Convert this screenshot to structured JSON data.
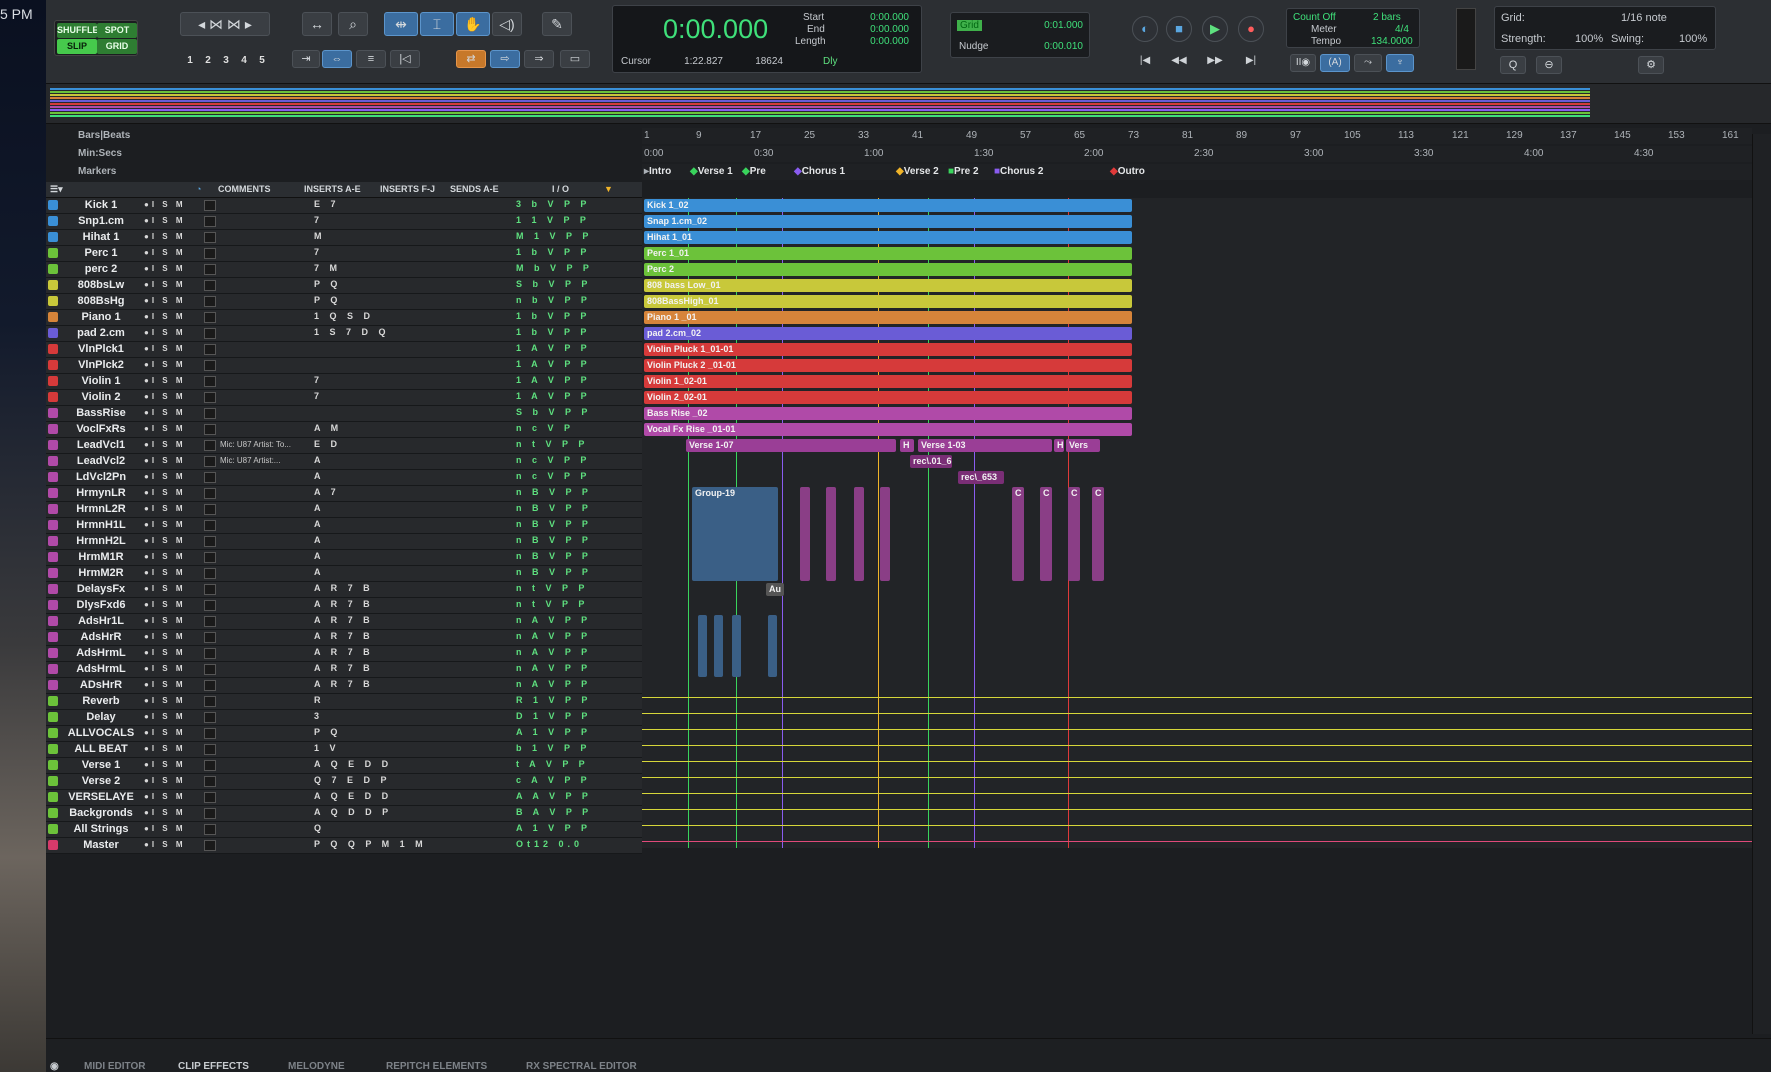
{
  "desktop": {
    "clock": "5 PM"
  },
  "toolbar": {
    "modes": {
      "shuffle": "SHUFFLE",
      "spot": "SPOT",
      "slip": "SLIP",
      "grid": "GRID"
    },
    "zoom_presets": [
      "1",
      "2",
      "3",
      "4",
      "5"
    ],
    "counter": {
      "main": "0:00.000",
      "start_label": "Start",
      "end_label": "End",
      "length_label": "Length",
      "start": "0:00.000",
      "end": "0:00.000",
      "length": "0:00.000",
      "cursor_label": "Cursor",
      "cursor": "1:22.827",
      "sample": "18624",
      "dly": "Dly"
    },
    "grid": {
      "label": "Grid",
      "value": "0:01.000",
      "nudge_label": "Nudge",
      "nudge_value": "0:00.010"
    },
    "meter": {
      "count_off": "Count Off",
      "bars": "2 bars",
      "meter_label": "Meter",
      "meter_value": "4/4",
      "tempo_label": "Tempo",
      "tempo_value": "134.0000"
    },
    "right": {
      "grid_label": "Grid:",
      "grid_note": "1/16 note",
      "strength_label": "Strength:",
      "strength": "100%",
      "swing_label": "Swing:",
      "swing": "100%"
    }
  },
  "rulers": {
    "bars_label": "Bars|Beats",
    "minsecs_label": "Min:Secs",
    "markers_label": "Markers",
    "bars": [
      "1",
      "9",
      "17",
      "25",
      "33",
      "41",
      "49",
      "57",
      "65",
      "73",
      "81",
      "89",
      "97",
      "105",
      "113",
      "121",
      "129",
      "137",
      "145",
      "153",
      "161"
    ],
    "secs": [
      "0:00",
      "0:30",
      "1:00",
      "1:30",
      "2:00",
      "2:30",
      "3:00",
      "3:30",
      "4:00",
      "4:30"
    ],
    "markers": [
      {
        "name": "Intro",
        "color": "#aab0b6"
      },
      {
        "name": "Verse 1",
        "color": "#39d45c"
      },
      {
        "name": "Pre",
        "color": "#39d45c"
      },
      {
        "name": "Chorus 1",
        "color": "#8a5cf0"
      },
      {
        "name": "Verse 2",
        "color": "#f0b429"
      },
      {
        "name": "Pre 2",
        "color": "#39d45c"
      },
      {
        "name": "Chorus 2",
        "color": "#8a5cf0"
      },
      {
        "name": "Outro",
        "color": "#e03a3a"
      }
    ]
  },
  "columns": {
    "comments": "COMMENTS",
    "inserts_ae": "INSERTS A-E",
    "inserts_fj": "INSERTS F-J",
    "sends_ae": "SENDS A-E",
    "io": "I / O"
  },
  "tracks": [
    {
      "name": "Kick 1",
      "color": "#3a8fd6",
      "ins": "E 7",
      "comment": "",
      "io": "3 b V P P"
    },
    {
      "name": "Snp1.cm",
      "color": "#3a8fd6",
      "ins": "7",
      "comment": "",
      "io": "1 1 V P P"
    },
    {
      "name": "Hihat 1",
      "color": "#3a8fd6",
      "ins": "M",
      "comment": "",
      "io": "M 1 V P P"
    },
    {
      "name": "Perc 1",
      "color": "#6cc23a",
      "ins": "7",
      "comment": "",
      "io": "1 b V P P"
    },
    {
      "name": "perc 2",
      "color": "#6cc23a",
      "ins": "7 M",
      "comment": "",
      "io": "M b V P P"
    },
    {
      "name": "808bsLw",
      "color": "#c8c83a",
      "ins": "P Q",
      "comment": "",
      "io": "S b V P P"
    },
    {
      "name": "808BsHg",
      "color": "#c8c83a",
      "ins": "P Q",
      "comment": "",
      "io": "n b V P P"
    },
    {
      "name": "Piano 1",
      "color": "#d6843a",
      "ins": "1 Q S D",
      "comment": "",
      "io": "1 b V P P"
    },
    {
      "name": "pad 2.cm",
      "color": "#6a5cd6",
      "ins": "1 S 7 D Q",
      "comment": "",
      "io": "1 b V P P"
    },
    {
      "name": "VlnPlck1",
      "color": "#d63a3a",
      "ins": "",
      "comment": "",
      "io": "1 A V P P"
    },
    {
      "name": "VlnPlck2",
      "color": "#d63a3a",
      "ins": "",
      "comment": "",
      "io": "1 A V P P"
    },
    {
      "name": "Violin 1",
      "color": "#d63a3a",
      "ins": "7",
      "comment": "",
      "io": "1 A V P P"
    },
    {
      "name": "Violin 2",
      "color": "#d63a3a",
      "ins": "7",
      "comment": "",
      "io": "1 A V P P"
    },
    {
      "name": "BassRise",
      "color": "#b04aa8",
      "ins": "",
      "comment": "",
      "io": "S b V P P"
    },
    {
      "name": "VoclFxRs",
      "color": "#b04aa8",
      "ins": "A M",
      "comment": "",
      "io": "n c V P"
    },
    {
      "name": "LeadVcl1",
      "color": "#b04aa8",
      "ins": "E D",
      "comment": "Mic: U87 Artist: To...",
      "io": "n t V P P"
    },
    {
      "name": "LeadVcl2",
      "color": "#b04aa8",
      "ins": "A",
      "comment": "Mic: U87 Artist:...",
      "io": "n c V P P"
    },
    {
      "name": "LdVcl2Pn",
      "color": "#b04aa8",
      "ins": "A",
      "comment": "",
      "io": "n c V P P"
    },
    {
      "name": "HrmynLR",
      "color": "#b04aa8",
      "ins": "A 7",
      "comment": "",
      "io": "n B V P P"
    },
    {
      "name": "HrmnL2R",
      "color": "#b04aa8",
      "ins": "A",
      "comment": "",
      "io": "n B V P P"
    },
    {
      "name": "HrmnH1L",
      "color": "#b04aa8",
      "ins": "A",
      "comment": "",
      "io": "n B V P P"
    },
    {
      "name": "HrmnH2L",
      "color": "#b04aa8",
      "ins": "A",
      "comment": "",
      "io": "n B V P P"
    },
    {
      "name": "HrmM1R",
      "color": "#b04aa8",
      "ins": "A",
      "comment": "",
      "io": "n B V P P"
    },
    {
      "name": "HrmM2R",
      "color": "#b04aa8",
      "ins": "A",
      "comment": "",
      "io": "n B V P P"
    },
    {
      "name": "DelaysFx",
      "color": "#b04aa8",
      "ins": "A R 7 B",
      "comment": "",
      "io": "n t V P P"
    },
    {
      "name": "DlysFxd6",
      "color": "#b04aa8",
      "ins": "A R 7 B",
      "comment": "",
      "io": "n t V P P"
    },
    {
      "name": "AdsHr1L",
      "color": "#b04aa8",
      "ins": "A R 7 B",
      "comment": "",
      "io": "n A V P P"
    },
    {
      "name": "AdsHrR",
      "color": "#b04aa8",
      "ins": "A R 7 B",
      "comment": "",
      "io": "n A V P P"
    },
    {
      "name": "AdsHrmL",
      "color": "#b04aa8",
      "ins": "A R 7 B",
      "comment": "",
      "io": "n A V P P"
    },
    {
      "name": "AdsHrmL",
      "color": "#b04aa8",
      "ins": "A R 7 B",
      "comment": "",
      "io": "n A V P P"
    },
    {
      "name": "ADsHrR",
      "color": "#b04aa8",
      "ins": "A R 7 B",
      "comment": "",
      "io": "n A V P P"
    },
    {
      "name": "Reverb",
      "color": "#6cc23a",
      "ins": "R",
      "comment": "",
      "io": "R 1 V P P"
    },
    {
      "name": "Delay",
      "color": "#6cc23a",
      "ins": "3",
      "comment": "",
      "io": "D 1 V P P"
    },
    {
      "name": "ALLVOCALS",
      "color": "#6cc23a",
      "ins": "P Q",
      "comment": "",
      "io": "A 1 V P P"
    },
    {
      "name": "ALL BEAT",
      "color": "#6cc23a",
      "ins": "1 V",
      "comment": "",
      "io": "b 1 V P P"
    },
    {
      "name": "Verse 1",
      "color": "#6cc23a",
      "ins": "A Q E D D",
      "comment": "",
      "io": "t A V P P"
    },
    {
      "name": "Verse 2",
      "color": "#6cc23a",
      "ins": "Q 7 E D P",
      "comment": "",
      "io": "c A V P P"
    },
    {
      "name": "VERSELAYE",
      "color": "#6cc23a",
      "ins": "A Q E D D",
      "comment": "",
      "io": "A A V P P"
    },
    {
      "name": "Backgronds",
      "color": "#6cc23a",
      "ins": "A Q D D P",
      "comment": "",
      "io": "B A V P P"
    },
    {
      "name": "All Strings",
      "color": "#6cc23a",
      "ins": "Q",
      "comment": "",
      "io": "A 1 V P P"
    },
    {
      "name": "Master",
      "color": "#d63a6a",
      "ins": "P Q Q P M 1 M",
      "comment": "",
      "io": "Ot12 0.0"
    }
  ],
  "clips": [
    {
      "label": "Kick 1_02",
      "color": "#3a8fd6"
    },
    {
      "label": "Snap 1.cm_02",
      "color": "#3a8fd6"
    },
    {
      "label": "Hihat 1_01",
      "color": "#3a8fd6"
    },
    {
      "label": "Perc 1_01",
      "color": "#6cc23a"
    },
    {
      "label": "Perc 2",
      "color": "#6cc23a"
    },
    {
      "label": "808 bass Low_01",
      "color": "#c8c83a"
    },
    {
      "label": "808BassHigh_01",
      "color": "#c8c83a"
    },
    {
      "label": "Piano 1 _01",
      "color": "#d6843a"
    },
    {
      "label": "pad 2.cm_02",
      "color": "#6a5cd6"
    },
    {
      "label": "Violin Pluck 1_01-01",
      "color": "#d63a3a"
    },
    {
      "label": "Violin Pluck 2 _01-01",
      "color": "#d63a3a"
    },
    {
      "label": "Violin 1_02-01",
      "color": "#d63a3a"
    },
    {
      "label": "Violin 2_02-01",
      "color": "#d63a3a"
    },
    {
      "label": "Bass Rise _02",
      "color": "#b04aa8"
    },
    {
      "label": "Vocal Fx Rise _01-01",
      "color": "#b04aa8"
    }
  ],
  "vocal_clips": {
    "verse1": "Verse 1-07",
    "h": "H",
    "verse1b": "Verse 1-03",
    "h2": "H",
    "verse_c": "Vers",
    "rec1": "rec\\.01_6",
    "rec2": "rec\\_653",
    "group": "Group-19",
    "au": "Au",
    "c": "C"
  },
  "bottom_tabs": [
    "MIDI EDITOR",
    "CLIP EFFECTS",
    "MELODYNE",
    "REPITCH ELEMENTS",
    "RX SPECTRAL EDITOR"
  ]
}
